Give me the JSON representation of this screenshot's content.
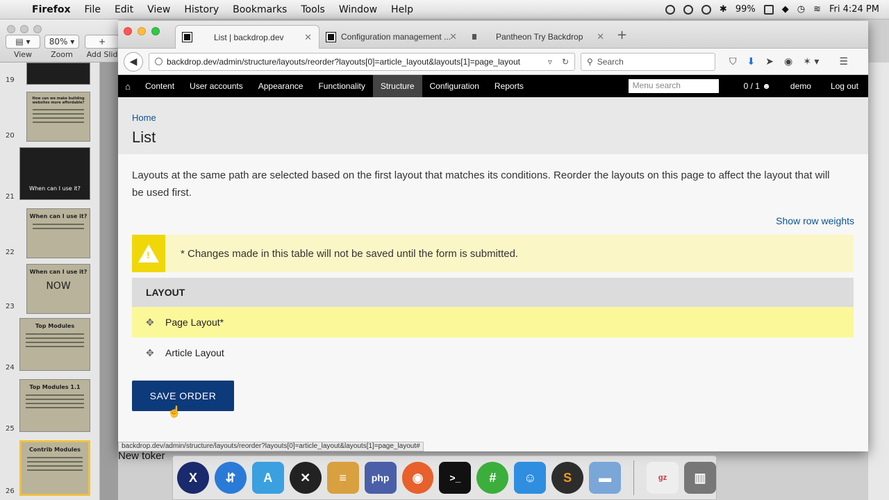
{
  "menubar": {
    "app": "Firefox",
    "items": [
      "File",
      "Edit",
      "View",
      "History",
      "Bookmarks",
      "Tools",
      "Window",
      "Help"
    ],
    "battery": "99%",
    "clock": "Fri 4:24 PM"
  },
  "keynote": {
    "view_label": "View",
    "zoom_value": "80%",
    "zoom_label": "Zoom",
    "add_slide_label": "Add Slid",
    "slides": [
      {
        "num": "19",
        "title": ""
      },
      {
        "num": "20",
        "title": "How can we make building websites more affordable?"
      },
      {
        "num": "21",
        "title": "When can I use it?"
      },
      {
        "num": "22",
        "title": "When can I use it?"
      },
      {
        "num": "23",
        "title": "When can I use it?",
        "big": "NOW"
      },
      {
        "num": "24",
        "title": "Top Modules"
      },
      {
        "num": "25",
        "title": "Top Modules 1.1"
      },
      {
        "num": "26",
        "title": "Contrib Modules"
      }
    ],
    "bottom_text": "New toker"
  },
  "browser": {
    "tabs": [
      {
        "title": "List | backdrop.dev"
      },
      {
        "title": "Configuration management ..."
      },
      {
        "title": "Pantheon Try Backdrop"
      }
    ],
    "url": "backdrop.dev/admin/structure/layouts/reorder?layouts[0]=article_layout&layouts[1]=page_layout",
    "search_placeholder": "Search",
    "status_url": "backdrop.dev/admin/structure/layouts/reorder?layouts[0]=article_layout&layouts[1]=page_layout#"
  },
  "admin": {
    "items": [
      "Content",
      "User accounts",
      "Appearance",
      "Functionality",
      "Structure",
      "Configuration",
      "Reports"
    ],
    "active": "Structure",
    "menu_search_placeholder": "Menu search",
    "counter": "0 / 1",
    "user": "demo",
    "logout": "Log out"
  },
  "page": {
    "breadcrumb": "Home",
    "title": "List",
    "description": "Layouts at the same path are selected based on the first layout that matches its conditions. Reorder the layouts on this page to affect the layout that will be used first.",
    "show_row_weights": "Show row weights",
    "warning": "* Changes made in this table will not be saved until the form is submitted.",
    "table_header": "LAYOUT",
    "rows": [
      "Page Layout*",
      "Article Layout"
    ],
    "save_button": "SAVE ORDER"
  },
  "colors": {
    "save_button": "#0d3a7a",
    "warning_bg": "#fbf6c6",
    "warning_icon": "#f0d70a",
    "highlight_row": "#fbf899",
    "admin_bar": "#000000"
  },
  "dock_icons": [
    "x-icon",
    "network-icon",
    "xcode-icon",
    "tools-icon",
    "database-icon",
    "php-icon",
    "firefox-icon",
    "terminal-icon",
    "hashtag-icon",
    "finder-icon",
    "sublime-icon",
    "keynote-icon",
    "archive-icon",
    "trash-icon"
  ]
}
